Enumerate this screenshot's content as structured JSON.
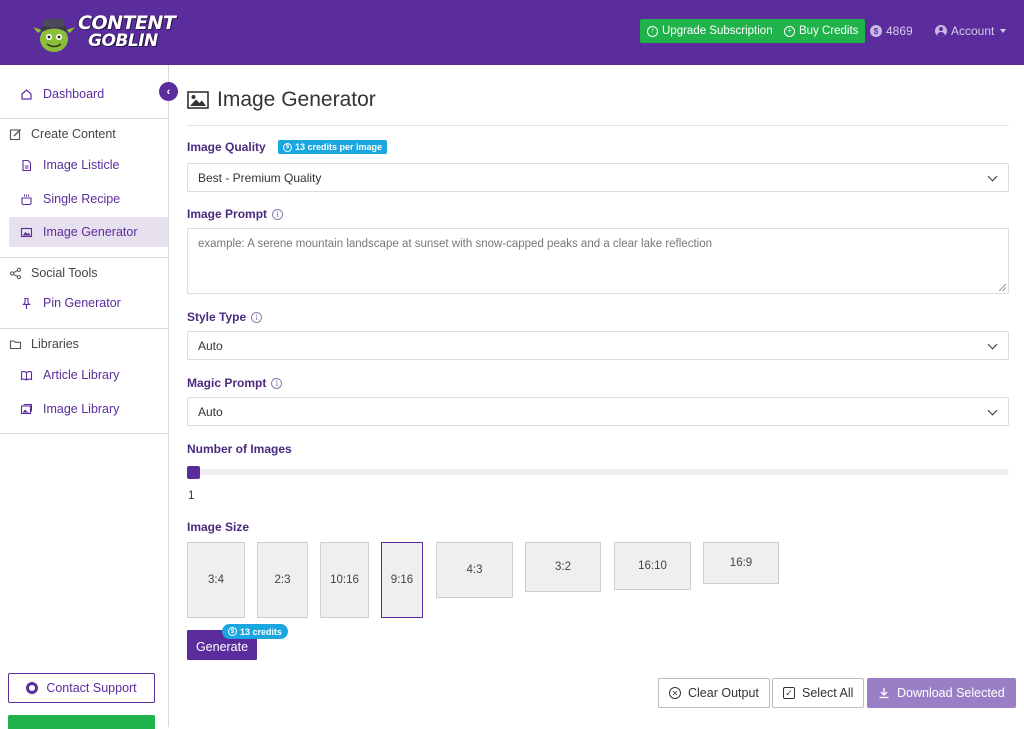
{
  "header": {
    "logo_line1": "CONTENT",
    "logo_line2": "GOBLIN",
    "upgrade_label": "Upgrade Subscription",
    "buy_credits_label": "Buy Credits",
    "credits_balance": "4869",
    "account_label": "Account",
    "brand_color": "#5b2d9c",
    "accent_green": "#21b34b"
  },
  "sidebar": {
    "dashboard": "Dashboard",
    "create_content": "Create Content",
    "image_listicle": "Image Listicle",
    "single_recipe": "Single Recipe",
    "image_generator": "Image Generator",
    "social_tools": "Social Tools",
    "pin_generator": "Pin Generator",
    "libraries": "Libraries",
    "article_library": "Article Library",
    "image_library": "Image Library",
    "contact_support": "Contact Support"
  },
  "main": {
    "title": "Image Generator",
    "quality": {
      "label": "Image Quality",
      "badge": "13 credits per image",
      "value": "Best - Premium Quality"
    },
    "prompt": {
      "label": "Image Prompt",
      "placeholder": "example: A serene mountain landscape at sunset with snow-capped peaks and a clear lake reflection"
    },
    "style": {
      "label": "Style Type",
      "value": "Auto"
    },
    "magic": {
      "label": "Magic Prompt",
      "value": "Auto"
    },
    "count": {
      "label": "Number of Images",
      "value": "1"
    },
    "size": {
      "label": "Image Size",
      "options": [
        "3:4",
        "2:3",
        "10:16",
        "9:16",
        "4:3",
        "3:2",
        "16:10",
        "16:9"
      ],
      "selected": "9:16"
    },
    "generate_label": "Generate",
    "generate_badge": "13 credits",
    "clear_output": "Clear Output",
    "select_all": "Select All",
    "download_selected": "Download Selected"
  }
}
